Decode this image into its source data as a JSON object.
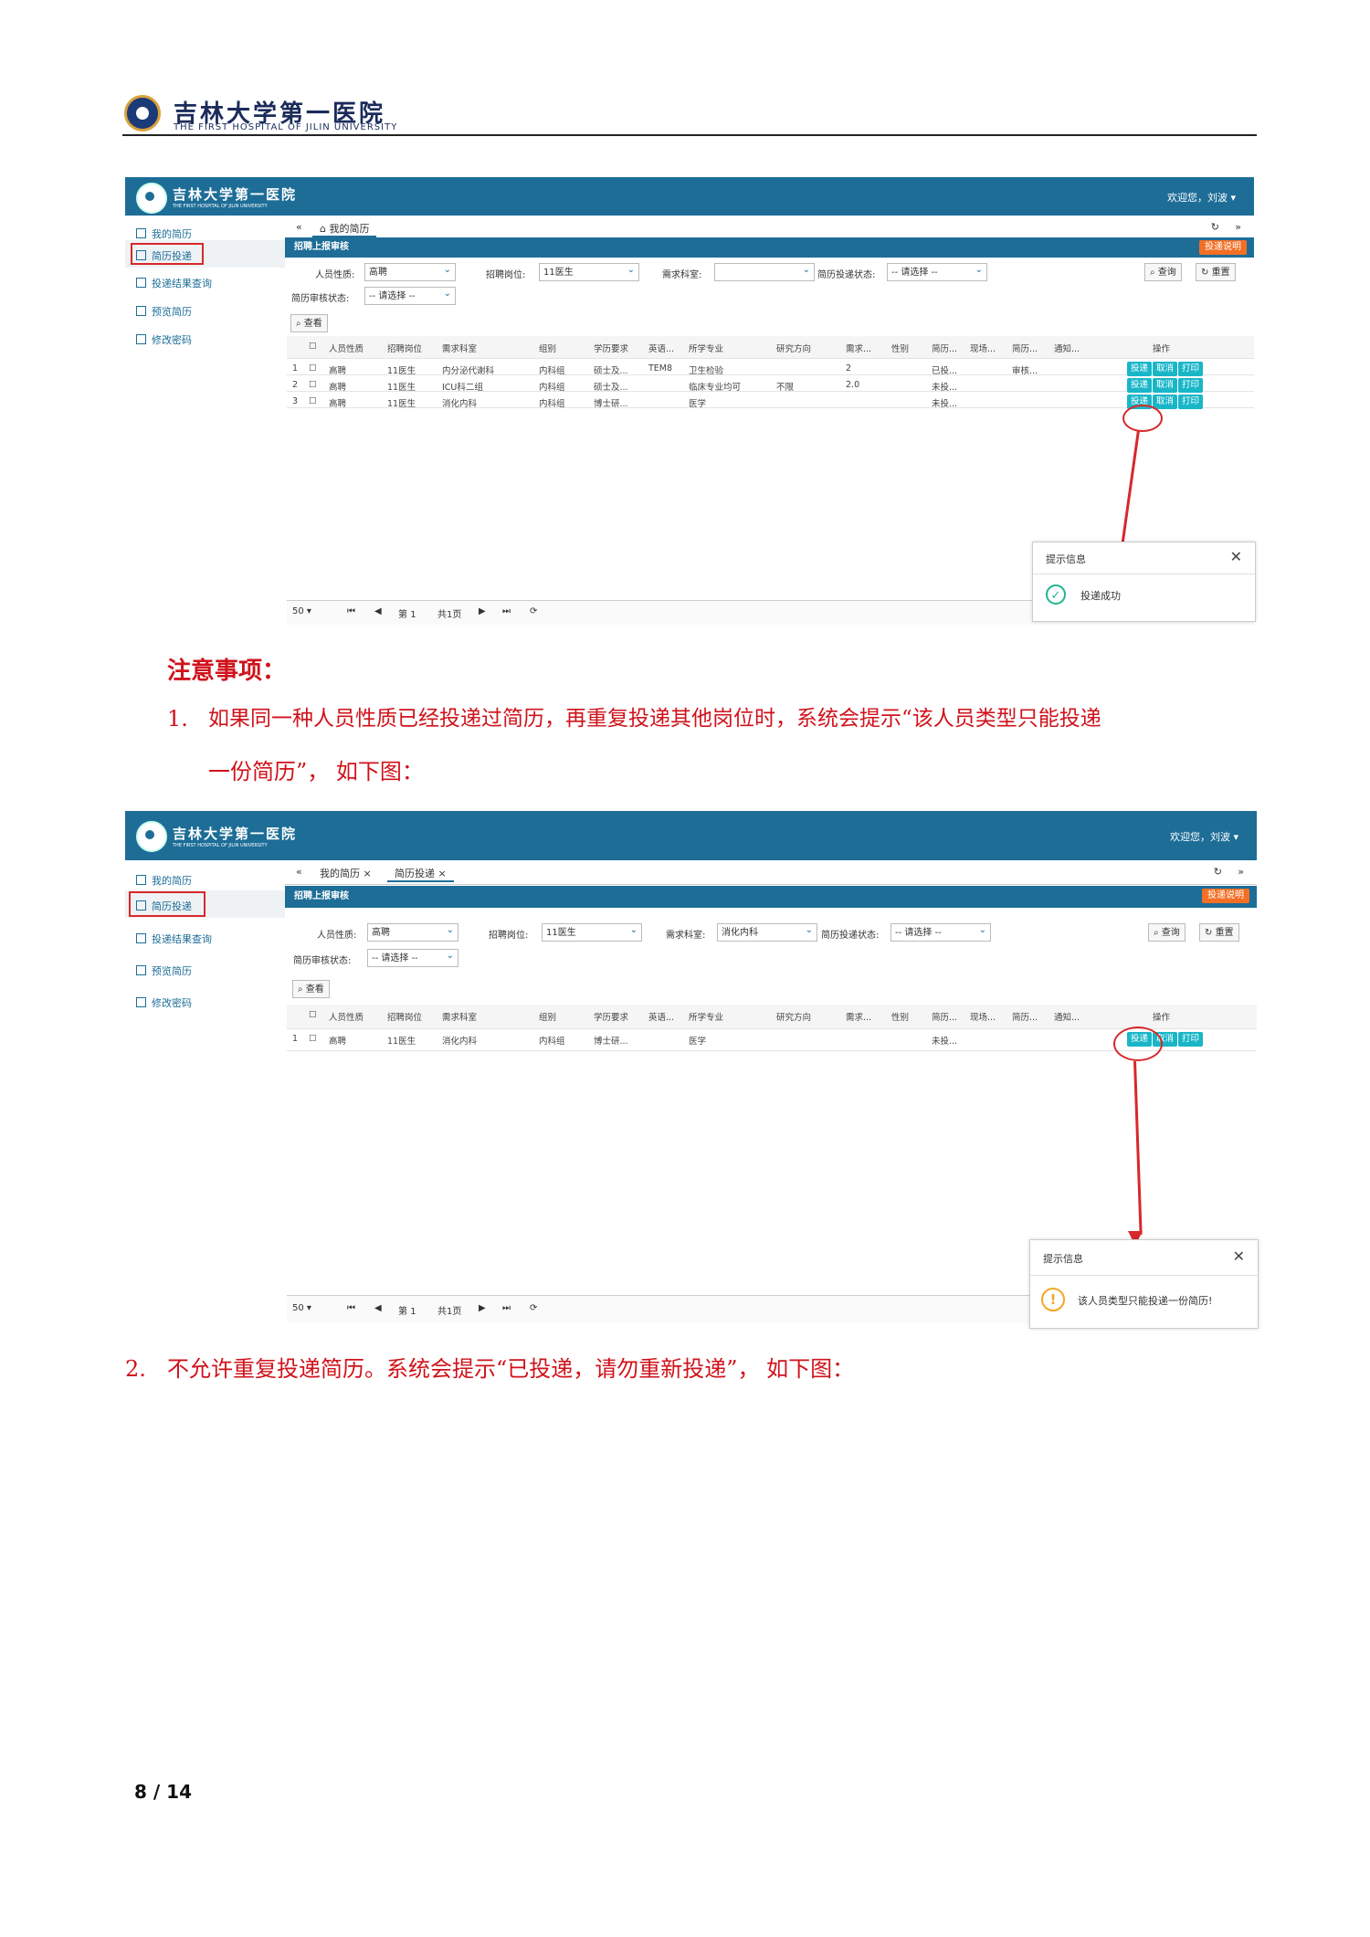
{
  "header": {
    "hospital_name": "吉林大学第一医院",
    "hospital_name_en": "THE FIRST HOSPITAL OF JILIN UNIVERSITY"
  },
  "app": {
    "brand": "吉林大学第一医院",
    "brand_en": "THE FIRST HOSPITAL OF JILIN UNIVERSITY",
    "welcome": "欢迎您，刘波 ▾",
    "sidebar": [
      "我的简历",
      "简历投递",
      "投递结果查询",
      "预览简历",
      "修改密码"
    ],
    "tab_my_resume": "我的简历",
    "tab_submit": "简历投递",
    "panel_title": "招聘上报审核",
    "help_button": "投递说明",
    "filters": {
      "person_type_label": "人员性质:",
      "person_type_value": "高聘",
      "position_label": "招聘岗位:",
      "position_value": "11医生",
      "dept_label": "需求科室:",
      "dept_value_2": "消化内科",
      "status_label": "简历投递状态:",
      "status_value": "-- 请选择 --",
      "review_label": "简历审核状态:",
      "review_value": "-- 请选择 --",
      "query": "查询",
      "reset": "重置",
      "view": "查看"
    },
    "columns": [
      "人员性质",
      "招聘岗位",
      "需求科室",
      "组别",
      "学历要求",
      "英语...",
      "所学专业",
      "研究方向",
      "需求...",
      "性别",
      "简历...",
      "现场...",
      "简历...",
      "通知...",
      "操作"
    ],
    "rows_1": [
      {
        "n": "1",
        "cells": [
          "高聘",
          "11医生",
          "内分泌代谢科",
          "内科组",
          "硕士及...",
          "TEM8",
          "卫生检验",
          "",
          "2",
          "",
          "已投...",
          "",
          "审核..."
        ]
      },
      {
        "n": "2",
        "cells": [
          "高聘",
          "11医生",
          "ICU科二组",
          "内科组",
          "硕士及...",
          "",
          "临床专业均可",
          "不限",
          "2.0",
          "",
          "未投...",
          "",
          ""
        ]
      },
      {
        "n": "3",
        "cells": [
          "高聘",
          "11医生",
          "消化内科",
          "内科组",
          "博士研...",
          "",
          "医学",
          "",
          "",
          "",
          "未投...",
          "",
          ""
        ]
      }
    ],
    "rows_2": [
      {
        "n": "1",
        "cells": [
          "高聘",
          "11医生",
          "消化内科",
          "内科组",
          "博士研...",
          "",
          "医学",
          "",
          "",
          "",
          "未投...",
          "",
          ""
        ]
      }
    ],
    "actions": [
      "投递",
      "取消",
      "打印"
    ],
    "pager": {
      "size": "50",
      "page_prefix": "第",
      "page": "1",
      "total": "共1页"
    },
    "toast_title": "提示信息",
    "toast_success": "投递成功",
    "toast_warning": "该人员类型只能投递一份简历!"
  },
  "notes": {
    "title": "注意事项：",
    "item1_num": "1.",
    "item1_line1": "如果同一种人员性质已经投递过简历，再重复投递其他岗位时，系统会提示“该人员类型只能投递",
    "item1_line2": "一份简历”， 如下图：",
    "item2_num": "2.",
    "item2_text": "不允许重复投递简历。系统会提示“已投递，请勿重新投递”， 如下图："
  },
  "page_number": "8 / 14"
}
